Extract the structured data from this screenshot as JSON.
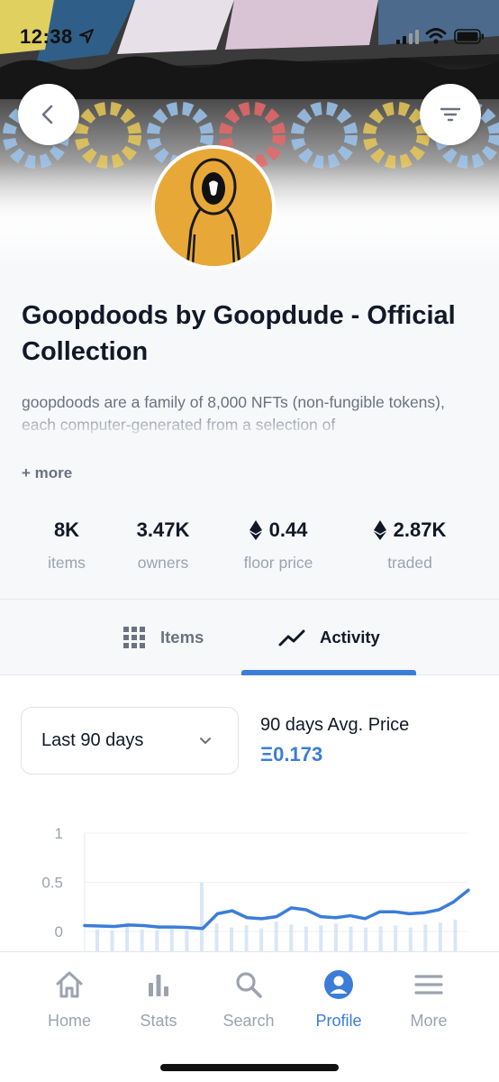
{
  "status_bar": {
    "time": "12:38"
  },
  "header": {
    "back_icon": "chevron-left-icon",
    "filter_icon": "filter-lines-icon"
  },
  "collection": {
    "title": "Goopdoods by Goopdude - Official Collection",
    "description": "goopdoods are a family of 8,000 NFTs (non-fungible tokens), each computer-generated from a selection of",
    "more_label": "+ more",
    "avatar_color": "#e8a838"
  },
  "stats": [
    {
      "value": "8K",
      "label": "items",
      "eth": false
    },
    {
      "value": "3.47K",
      "label": "owners",
      "eth": false
    },
    {
      "value": "0.44",
      "label": "floor price",
      "eth": true
    },
    {
      "value": "2.87K",
      "label": "traded",
      "eth": true
    }
  ],
  "tabs": [
    {
      "label": "Items",
      "icon": "grid-icon",
      "active": false
    },
    {
      "label": "Activity",
      "icon": "trend-line-icon",
      "active": true
    }
  ],
  "activity": {
    "range_selected": "Last 90 days",
    "avg_label": "90 days Avg. Price",
    "avg_value": "Ξ0.173"
  },
  "chart_data": {
    "type": "line",
    "ytick_labels": [
      "1",
      "0.5",
      "0"
    ],
    "ylim": [
      0,
      1
    ],
    "grid": true,
    "series": [
      {
        "values": [
          0.06,
          0.055,
          0.05,
          0.065,
          0.06,
          0.045,
          0.045,
          0.04,
          0.03,
          0.18,
          0.21,
          0.14,
          0.13,
          0.15,
          0.24,
          0.22,
          0.15,
          0.14,
          0.16,
          0.13,
          0.2,
          0.2,
          0.18,
          0.19,
          0.22,
          0.3,
          0.42
        ]
      }
    ],
    "volume_bars": [
      0.02,
      0.01,
      0.09,
      0.02,
      0.01,
      0.03,
      0.01,
      0.5,
      0.08,
      0.04,
      0.06,
      0.03,
      0.1,
      0.07,
      0.05,
      0.06,
      0.08,
      0.05,
      0.04,
      0.05,
      0.06,
      0.04,
      0.07,
      0.09,
      0.12
    ],
    "accent_color": "#3b7dd8"
  },
  "bottom_nav": [
    {
      "label": "Home",
      "icon": "home-icon",
      "active": false
    },
    {
      "label": "Stats",
      "icon": "bar-chart-icon",
      "active": false
    },
    {
      "label": "Search",
      "icon": "search-icon",
      "active": false
    },
    {
      "label": "Profile",
      "icon": "profile-icon",
      "active": true
    },
    {
      "label": "More",
      "icon": "menu-icon",
      "active": false
    }
  ],
  "colors": {
    "accent": "#3b7dd8",
    "muted": "#9ca3af",
    "text": "#111827"
  }
}
